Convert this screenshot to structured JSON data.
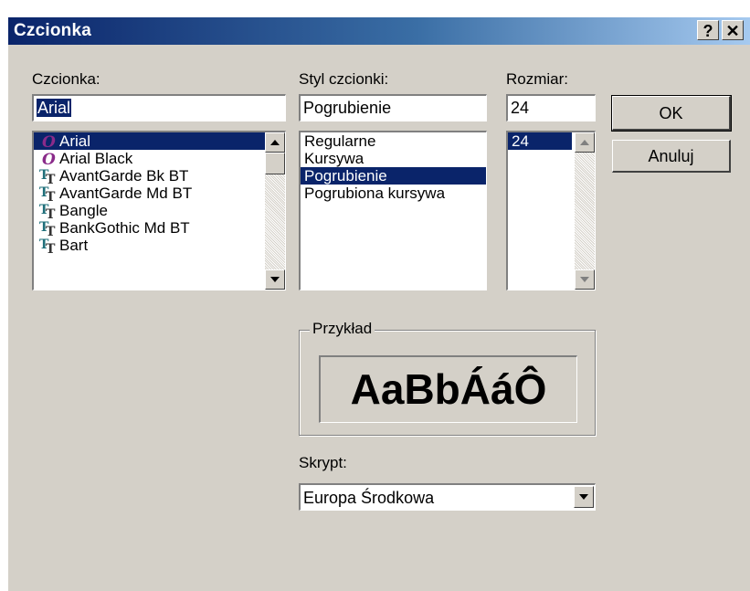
{
  "window": {
    "title": "Czcionka",
    "help_label": "?",
    "close_label": "✕"
  },
  "font": {
    "label": "Czcionka:",
    "value": "Arial",
    "items": [
      {
        "label": "Arial",
        "icon": "opentype-icon"
      },
      {
        "label": "Arial Black",
        "icon": "opentype-icon"
      },
      {
        "label": "AvantGarde Bk BT",
        "icon": "truetype-icon"
      },
      {
        "label": "AvantGarde Md BT",
        "icon": "truetype-icon"
      },
      {
        "label": "Bangle",
        "icon": "truetype-icon"
      },
      {
        "label": "BankGothic Md BT",
        "icon": "truetype-icon"
      },
      {
        "label": "Bart",
        "icon": "truetype-icon"
      }
    ],
    "selected": "Arial"
  },
  "style": {
    "label": "Styl czcionki:",
    "value": "Pogrubienie",
    "items": [
      "Regularne",
      "Kursywa",
      "Pogrubienie",
      "Pogrubiona kursywa"
    ],
    "selected": "Pogrubienie"
  },
  "size": {
    "label": "Rozmiar:",
    "value": "24",
    "items": [
      "24"
    ],
    "selected": "24"
  },
  "buttons": {
    "ok": "OK",
    "cancel": "Anuluj"
  },
  "sample": {
    "label": "Przykład",
    "text": "AaBbÁáÔ"
  },
  "script": {
    "label": "Skrypt:",
    "value": "Europa Środkowa"
  },
  "colors": {
    "titlebar_start": "#0a246a",
    "titlebar_end": "#a6caf0",
    "selection": "#0a246a",
    "face": "#d4d0c8"
  }
}
